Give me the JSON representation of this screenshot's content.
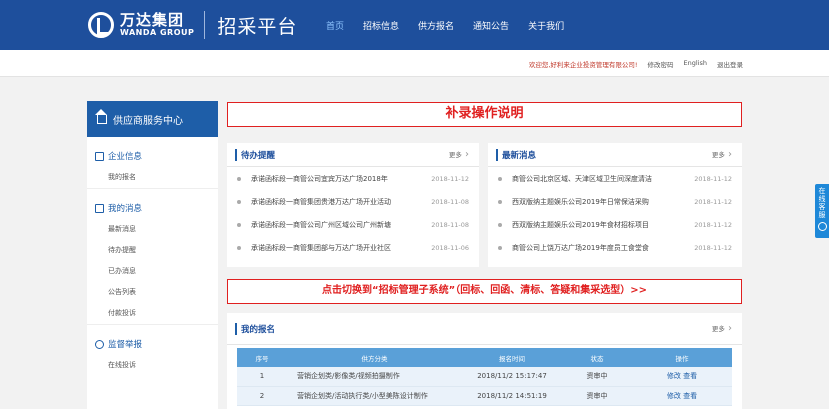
{
  "header": {
    "logo_cn": "万达集团",
    "logo_en": "WANDA GROUP",
    "platform": "招采平台",
    "nav": [
      "首页",
      "招标信息",
      "供方报名",
      "通知公告",
      "关于我们"
    ],
    "active_nav": "首页"
  },
  "userbar": {
    "welcome": "欢迎您,好利来企业投资管理有限公司!",
    "change_password": "修改密码",
    "english": "English",
    "logout": "退出登录"
  },
  "sidebar": {
    "title": "供应商服务中心",
    "groups": [
      {
        "title": "企业信息",
        "items": [
          "我的报名"
        ]
      },
      {
        "title": "我的消息",
        "items": [
          "最新消息",
          "待办提醒",
          "已办消息",
          "公告列表",
          "付款投诉"
        ]
      },
      {
        "title": "监督举报",
        "items": [
          "在线投诉"
        ]
      }
    ]
  },
  "notices": {
    "top": "补录操作说明",
    "switch": "点击切换到“招标管理子系统”（回标、回函、清标、答疑和集采选型）>>"
  },
  "todo": {
    "title": "待办提醒",
    "more": "更多",
    "rows": [
      {
        "text": "承诺函标段一商管公司宜宾万达广场2018年",
        "date": "2018-11-12"
      },
      {
        "text": "承诺函标段一商管集团贵港万达广场开业活动",
        "date": "2018-11-08"
      },
      {
        "text": "承诺函标段一商管公司广州区域公司广州新塘",
        "date": "2018-11-08"
      },
      {
        "text": "承诺函标段一商管集团部与万达广场开业社区",
        "date": "2018-11-06"
      }
    ]
  },
  "news": {
    "title": "最新消息",
    "more": "更多",
    "rows": [
      {
        "text": "商管公司北京区域、天津区域卫生间深度清洁",
        "date": "2018-11-12"
      },
      {
        "text": "西双版纳主题娱乐公司2019年日常保洁采购",
        "date": "2018-11-12"
      },
      {
        "text": "西双版纳主题娱乐公司2019年食材招标项目",
        "date": "2018-11-12"
      },
      {
        "text": "商管公司上饶万达广场2019年度员工食堂食",
        "date": "2018-11-12"
      }
    ]
  },
  "signup": {
    "title": "我的报名",
    "more": "更多",
    "columns": [
      "序号",
      "供方分类",
      "报名时间",
      "状态",
      "操作"
    ],
    "rows": [
      {
        "no": "1",
        "category": "营销企划类/影像类/视频拍摄制作",
        "time": "2018/11/2 15:17:47",
        "status": "资审中",
        "edit": "修改",
        "view": "查看"
      },
      {
        "no": "2",
        "category": "营销企划类/活动执行类/小型美陈设计制作",
        "time": "2018/11/2 14:51:19",
        "status": "资审中",
        "edit": "修改",
        "view": "查看"
      }
    ]
  },
  "float_tab": "在线客服",
  "colors": {
    "header_bg": "#1e4f9c",
    "notice_red": "#e02020",
    "table_head": "#5aa0d8"
  }
}
